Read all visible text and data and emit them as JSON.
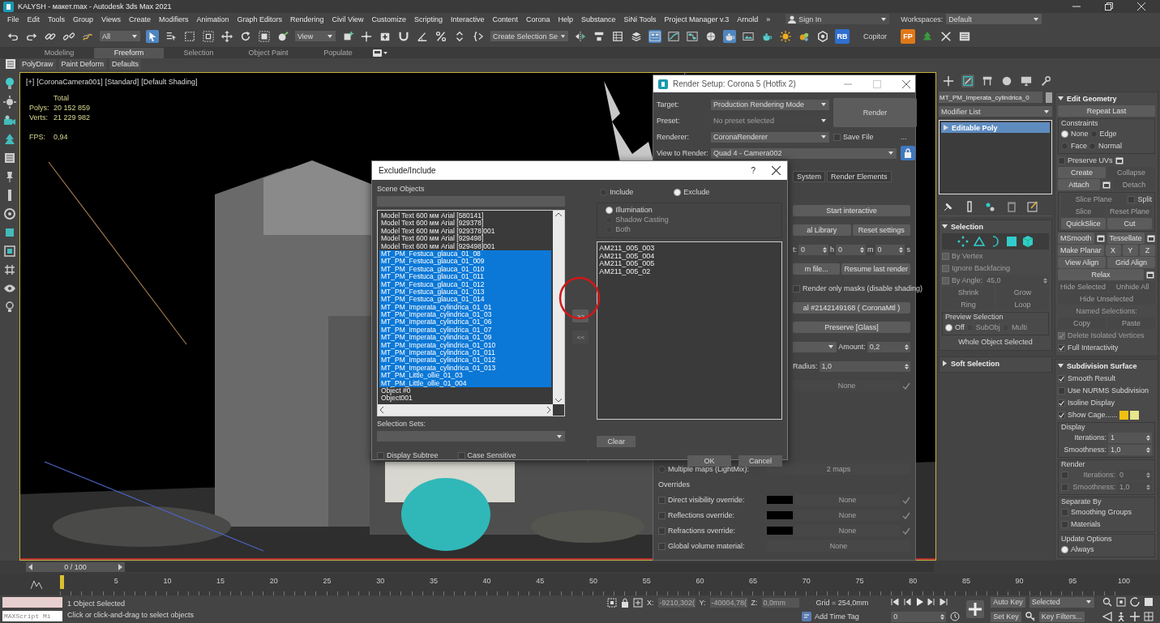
{
  "window": {
    "title": "KALYSH - макет.max - Autodesk 3ds Max 2021"
  },
  "menus": [
    "File",
    "Edit",
    "Tools",
    "Group",
    "Views",
    "Create",
    "Modifiers",
    "Animation",
    "Graph Editors",
    "Rendering",
    "Civil View",
    "Customize",
    "Scripting",
    "Interactive",
    "Content",
    "Corona",
    "Help",
    "Substance",
    "SiNi Tools",
    "Project Manager v.3",
    "Arnold"
  ],
  "more_menus": "»",
  "sign_in": "Sign In",
  "workspaces_label": "Workspaces:",
  "workspace": "Default",
  "toolbar": [
    {
      "kind": "icon",
      "on": false
    },
    {
      "kind": "icon",
      "on": false
    },
    {
      "kind": "icon",
      "on": false
    },
    {
      "kind": "icon",
      "on": false
    },
    {
      "kind": "icon",
      "on": false
    },
    {
      "kind": "dropdown",
      "text": "All"
    },
    {
      "kind": "icon",
      "on": true
    },
    {
      "kind": "icon",
      "on": false
    },
    {
      "kind": "icon",
      "on": false
    },
    {
      "kind": "icon",
      "on": false
    },
    {
      "kind": "icon",
      "on": false
    },
    {
      "kind": "icon",
      "on": false
    },
    {
      "kind": "icon",
      "on": false
    },
    {
      "kind": "icon",
      "on": false
    },
    {
      "kind": "dropdown",
      "text": "View"
    },
    {
      "kind": "icon",
      "on": false
    },
    {
      "kind": "icon",
      "on": false
    },
    {
      "kind": "icon",
      "on": false
    },
    {
      "kind": "icon",
      "on": false
    },
    {
      "kind": "icon",
      "on": false
    },
    {
      "kind": "icon",
      "on": false
    },
    {
      "kind": "icon",
      "on": false
    },
    {
      "kind": "icon",
      "on": false
    },
    {
      "kind": "dropdown",
      "text": "Create Selection Se"
    },
    {
      "kind": "icon",
      "on": false
    },
    {
      "kind": "icon",
      "on": false
    },
    {
      "kind": "icon",
      "on": false
    },
    {
      "kind": "icon",
      "on": false
    },
    {
      "kind": "icon",
      "on": true
    },
    {
      "kind": "icon",
      "on": false
    },
    {
      "kind": "icon",
      "on": false
    },
    {
      "kind": "icon",
      "on": false
    },
    {
      "kind": "icon",
      "on": true
    },
    {
      "kind": "icon",
      "on": false
    },
    {
      "kind": "icon",
      "on": false
    },
    {
      "kind": "icon",
      "on": false
    },
    {
      "kind": "icon",
      "on": false
    },
    {
      "kind": "icon",
      "on": false
    },
    {
      "kind": "badge",
      "text": "RB",
      "color": "#2f6fd0"
    },
    {
      "kind": "label",
      "text": "Copitor"
    },
    {
      "kind": "badge",
      "text": "FP",
      "color": "#e07818"
    },
    {
      "kind": "icon",
      "on": false
    },
    {
      "kind": "icon",
      "on": false
    },
    {
      "kind": "icon",
      "on": false
    }
  ],
  "ribbon": {
    "tabs": [
      {
        "text": "Modeling",
        "selected": false
      },
      {
        "text": "Freeform",
        "selected": true
      },
      {
        "text": "Selection",
        "selected": false
      },
      {
        "text": "Object Paint",
        "selected": false
      },
      {
        "text": "Populate",
        "selected": false
      }
    ],
    "panels": [
      "PolyDraw",
      "Paint Deform",
      "Defaults"
    ]
  },
  "viewport": {
    "labels": [
      "[+]",
      "[CoronaCamera001]",
      "[Standard]",
      "[Default Shading]"
    ],
    "stats": {
      "heading": "Total",
      "rows": [
        {
          "label": "Polys:",
          "value": "20 152 859"
        },
        {
          "label": "Verts:",
          "value": "21 229 982"
        }
      ],
      "fps_label": "FPS:",
      "fps": "0,94"
    }
  },
  "render_setup": {
    "title": "Render Setup: Corona 5 (Hotfix 2)",
    "target": {
      "label": "Target:",
      "value": "Production Rendering Mode"
    },
    "preset": {
      "label": "Preset:",
      "value": "No preset selected",
      "disabled": true
    },
    "renderer": {
      "label": "Renderer:",
      "value": "CoronaRenderer"
    },
    "render_button": "Render",
    "save_file": {
      "text": "Save File",
      "checked": false
    },
    "more_button": "...",
    "view": {
      "label": "View to Render:",
      "value": "Quad 4 - Camera002"
    },
    "lock": {
      "on": true
    },
    "tabs": [
      {
        "text": "System",
        "selected": false
      },
      {
        "text": "Render Elements",
        "selected": false
      }
    ],
    "band_rows": [
      [
        {
          "kind": "button",
          "text": "Start interactive",
          "disabled": false
        }
      ],
      [
        {
          "kind": "button",
          "text": "al Library",
          "disabled": false
        },
        {
          "kind": "button",
          "text": "Reset settings",
          "disabled": false
        }
      ],
      [
        {
          "kind": "label",
          "text": "t:",
          "disabled": false
        },
        {
          "kind": "spinner",
          "text": "0",
          "disabled": false
        },
        {
          "kind": "label",
          "text": "h",
          "disabled": false
        },
        {
          "kind": "spinner",
          "text": "0",
          "disabled": false
        },
        {
          "kind": "label",
          "text": "m",
          "disabled": false
        },
        {
          "kind": "spinner",
          "text": "0",
          "disabled": false
        },
        {
          "kind": "label",
          "text": "s",
          "disabled": false
        }
      ],
      [
        {
          "kind": "button",
          "text": "m file...",
          "disabled": false
        },
        {
          "kind": "button",
          "text": "Resume last render",
          "disabled": false
        }
      ],
      [
        {
          "kind": "checkbox",
          "text": "Render only masks (disable shading)",
          "checked": false,
          "disabled": false
        }
      ],
      [
        {
          "kind": "button",
          "text": "al #2142149168 ( CoronaMtl )",
          "disabled": false
        }
      ],
      [
        {
          "kind": "button",
          "text": "Preserve [Glass]",
          "disabled": false
        }
      ],
      [
        {
          "kind": "dropdown",
          "disabled": false
        },
        {
          "kind": "label",
          "text": "Amount:",
          "disabled": false
        },
        {
          "kind": "spinner",
          "text": "0,2",
          "disabled": false
        }
      ],
      [
        {
          "kind": "label",
          "text": "Radius:",
          "disabled": false
        },
        {
          "kind": "spinner",
          "text": "1,0",
          "disabled": false
        }
      ],
      [
        {
          "kind": "button",
          "text": "None",
          "disabled": true
        },
        {
          "kind": "tick",
          "checked": true,
          "disabled": true
        }
      ]
    ],
    "rows": [
      [
        {
          "kind": "radio",
          "text": "Multiple maps (LightMix):",
          "selected": false,
          "disabled": false
        },
        {
          "kind": "button",
          "text": "2 maps",
          "disabled": true
        }
      ],
      [
        {
          "kind": "label",
          "text": "Overrides",
          "disabled": false
        }
      ],
      [
        {
          "kind": "checkbox",
          "text": "Direct visibility override:",
          "checked": false,
          "disabled": false
        },
        {
          "kind": "swatch",
          "color": "#000000",
          "disabled": false
        },
        {
          "kind": "button",
          "text": "None",
          "disabled": true
        },
        {
          "kind": "tick",
          "checked": true,
          "disabled": true
        }
      ],
      [
        {
          "kind": "checkbox",
          "text": "Reflections override:",
          "checked": false,
          "disabled": false
        },
        {
          "kind": "swatch",
          "color": "#000000",
          "disabled": false
        },
        {
          "kind": "button",
          "text": "None",
          "disabled": true
        },
        {
          "kind": "tick",
          "checked": true,
          "disabled": true
        }
      ],
      [
        {
          "kind": "checkbox",
          "text": "Refractions override:",
          "checked": false,
          "disabled": false
        },
        {
          "kind": "swatch",
          "color": "#000000",
          "disabled": false
        },
        {
          "kind": "button",
          "text": "None",
          "disabled": true
        },
        {
          "kind": "tick",
          "checked": true,
          "disabled": true
        }
      ],
      [
        {
          "kind": "checkbox",
          "text": "Global volume material:",
          "checked": false,
          "disabled": false
        },
        {
          "kind": "button",
          "text": "None",
          "disabled": true
        }
      ]
    ]
  },
  "exclude_dialog": {
    "title": "Exclude/Include",
    "help": "?",
    "scene_label": "Scene Objects",
    "scene_objects": [
      {
        "text": "Model Text 600 мм Arial [580141]",
        "selected": false
      },
      {
        "text": "Model Text 600 мм Arial [929378]",
        "selected": false
      },
      {
        "text": "Model Text 600 мм Arial [929378]001",
        "selected": false
      },
      {
        "text": "Model Text 600 мм Arial [929498]",
        "selected": false
      },
      {
        "text": "Model Text 600 мм Arial [929498]001",
        "selected": false
      },
      {
        "text": "MT_PM_Festuca_glauca_01_08",
        "selected": true
      },
      {
        "text": "MT_PM_Festuca_glauca_01_009",
        "selected": true
      },
      {
        "text": "MT_PM_Festuca_glauca_01_010",
        "selected": true
      },
      {
        "text": "MT_PM_Festuca_glauca_01_011",
        "selected": true
      },
      {
        "text": "MT_PM_Festuca_glauca_01_012",
        "selected": true
      },
      {
        "text": "MT_PM_Festuca_glauca_01_013",
        "selected": true
      },
      {
        "text": "MT_PM_Festuca_glauca_01_014",
        "selected": true
      },
      {
        "text": "MT_PM_Imperata_cylindrica_01_01",
        "selected": true
      },
      {
        "text": "MT_PM_Imperata_cylindrica_01_03",
        "selected": true
      },
      {
        "text": "MT_PM_Imperata_cylindrica_01_06",
        "selected": true
      },
      {
        "text": "MT_PM_Imperata_cylindrica_01_07",
        "selected": true
      },
      {
        "text": "MT_PM_Imperata_cylindrica_01_09",
        "selected": true
      },
      {
        "text": "MT_PM_Imperata_cylindrica_01_010",
        "selected": true
      },
      {
        "text": "MT_PM_Imperata_cylindrica_01_011",
        "selected": true
      },
      {
        "text": "MT_PM_Imperata_cylindrica_01_012",
        "selected": true
      },
      {
        "text": "MT_PM_Imperata_cylindrica_01_013",
        "selected": true
      },
      {
        "text": "MT_PM_Little_ollie_01_03",
        "selected": true
      },
      {
        "text": "MT_PM_Little_ollie_01_004",
        "selected": true
      },
      {
        "text": "Object #0",
        "selected": false
      },
      {
        "text": "Object001",
        "selected": false
      }
    ],
    "move_right": {
      "text": ">>",
      "disabled": false
    },
    "move_left": {
      "text": "<<",
      "disabled": true
    },
    "mode": [
      {
        "text": "Include",
        "selected": false
      },
      {
        "text": "Exclude",
        "selected": true
      }
    ],
    "type": [
      {
        "text": "Illumination",
        "selected": true,
        "disabled": false
      },
      {
        "text": "Shadow Casting",
        "selected": false,
        "disabled": true
      },
      {
        "text": "Both",
        "selected": false,
        "disabled": true
      }
    ],
    "excluded": [
      "AM211_005_003",
      "AM211_005_004",
      "AM211_005_005",
      "AM211_005_02"
    ],
    "selection_sets_label": "Selection Sets:",
    "clear": "Clear",
    "options": [
      {
        "text": "Display Subtree",
        "checked": false
      },
      {
        "text": "Case Sensitive",
        "checked": false
      }
    ],
    "ok": "OK",
    "cancel": "Cancel"
  },
  "command_panel": {
    "tabs": [
      {
        "selected": false
      },
      {
        "selected": true
      },
      {
        "selected": false
      },
      {
        "selected": false
      },
      {
        "selected": false
      },
      {
        "selected": false
      }
    ],
    "object_name": "MT_PM_Imperata_cylindrica_0",
    "modifier_list": "Modifier List",
    "stack": [
      {
        "text": "Editable Poly",
        "selected": true
      }
    ],
    "left_rollouts": [
      {
        "title": "Selection",
        "expanded": true,
        "rows": [
          [
            {
              "kind": "subobj",
              "selected": false,
              "disabled": false
            },
            {
              "kind": "subobj",
              "selected": false,
              "disabled": false
            },
            {
              "kind": "subobj",
              "selected": false,
              "disabled": false
            },
            {
              "kind": "subobj",
              "selected": false,
              "disabled": false
            },
            {
              "kind": "subobj",
              "selected": false,
              "disabled": false
            }
          ],
          [
            {
              "kind": "checkbox",
              "text": "By Vertex",
              "checked": false,
              "disabled": true
            }
          ],
          [
            {
              "kind": "checkbox",
              "text": "Ignore Backfacing",
              "checked": false,
              "disabled": true
            }
          ],
          [
            {
              "kind": "checkbox",
              "text": "By Angle:",
              "checked": false,
              "disabled": true
            },
            {
              "kind": "spinner",
              "text": "45,0",
              "disabled": true
            }
          ],
          [
            {
              "kind": "button",
              "text": "Shrink",
              "disabled": true
            },
            {
              "kind": "button",
              "text": "Grow",
              "disabled": true
            }
          ],
          [
            {
              "kind": "button",
              "text": "Ring",
              "disabled": true
            },
            {
              "kind": "button",
              "text": "Loop",
              "disabled": true
            }
          ],
          {
            "title": "Preview Selection",
            "rows": [
              [
                {
                  "kind": "radio",
                  "text": "Off",
                  "selected": true,
                  "disabled": false
                },
                {
                  "kind": "radio",
                  "text": "SubObj",
                  "selected": false,
                  "disabled": true
                },
                {
                  "kind": "radio",
                  "text": "Multi",
                  "selected": false,
                  "disabled": true
                }
              ]
            ]
          },
          [
            {
              "kind": "label",
              "text": "Whole Object Selected",
              "disabled": false
            }
          ]
        ]
      },
      {
        "title": "Soft Selection",
        "expanded": false
      }
    ],
    "right_rollouts": [
      {
        "title": "Edit Geometry",
        "expanded": true,
        "rows": [
          [
            {
              "kind": "button",
              "text": "Repeat Last",
              "disabled": false
            }
          ],
          {
            "title": "Constraints",
            "rows": [
              [
                {
                  "kind": "radio",
                  "text": "None",
                  "selected": true,
                  "disabled": false
                },
                {
                  "kind": "radio",
                  "text": "Edge",
                  "selected": false,
                  "disabled": false
                }
              ],
              [
                {
                  "kind": "radio",
                  "text": "Face",
                  "selected": false,
                  "disabled": false
                },
                {
                  "kind": "radio",
                  "text": "Normal",
                  "selected": false,
                  "disabled": false
                }
              ]
            ]
          },
          [
            {
              "kind": "checkbox",
              "text": "Preserve UVs",
              "checked": false,
              "disabled": false
            },
            {
              "kind": "optbtn",
              "disabled": false
            }
          ],
          [
            {
              "kind": "button",
              "text": "Create",
              "disabled": false
            },
            {
              "kind": "button",
              "text": "Collapse",
              "disabled": true
            }
          ],
          [
            {
              "kind": "button",
              "text": "Attach",
              "disabled": false
            },
            {
              "kind": "optbtn",
              "disabled": false
            },
            {
              "kind": "button",
              "text": "Detach",
              "disabled": true
            }
          ],
          {
            "rows": [
              [
                {
                  "kind": "button",
                  "text": "Slice Plane",
                  "disabled": true
                },
                {
                  "kind": "checkbox",
                  "text": "Split",
                  "checked": false,
                  "disabled": false
                }
              ],
              [
                {
                  "kind": "button",
                  "text": "Slice",
                  "disabled": true
                },
                {
                  "kind": "button",
                  "text": "Reset Plane",
                  "disabled": true
                }
              ],
              [
                {
                  "kind": "button",
                  "text": "QuickSlice",
                  "disabled": false
                },
                {
                  "kind": "button",
                  "text": "Cut",
                  "disabled": false
                }
              ]
            ]
          },
          [
            {
              "kind": "button",
              "text": "MSmooth",
              "disabled": false
            },
            {
              "kind": "optbtn",
              "disabled": false
            },
            {
              "kind": "button",
              "text": "Tessellate",
              "disabled": false
            },
            {
              "kind": "optbtn",
              "disabled": false
            }
          ],
          [
            {
              "kind": "button",
              "text": "Make Planar",
              "disabled": false
            },
            {
              "kind": "button",
              "text": "X",
              "disabled": false
            },
            {
              "kind": "button",
              "text": "Y",
              "disabled": false
            },
            {
              "kind": "button",
              "text": "Z",
              "disabled": false
            }
          ],
          [
            {
              "kind": "button",
              "text": "View Align",
              "disabled": false
            },
            {
              "kind": "button",
              "text": "Grid Align",
              "disabled": false
            }
          ],
          [
            {
              "kind": "button",
              "text": "Relax",
              "disabled": false
            },
            {
              "kind": "optbtn",
              "disabled": false
            }
          ],
          [
            {
              "kind": "button",
              "text": "Hide Selected",
              "disabled": true
            },
            {
              "kind": "button",
              "text": "Unhide All",
              "disabled": true
            }
          ],
          [
            {
              "kind": "button",
              "text": "Hide Unselected",
              "disabled": true
            }
          ],
          [
            {
              "kind": "label",
              "text": "Named Selections:",
              "disabled": true
            }
          ],
          [
            {
              "kind": "button",
              "text": "Copy",
              "disabled": true
            },
            {
              "kind": "button",
              "text": "Paste",
              "disabled": true
            }
          ],
          [
            {
              "kind": "checkbox",
              "text": "Delete Isolated Vertices",
              "checked": true,
              "disabled": true
            }
          ],
          [
            {
              "kind": "checkbox",
              "text": "Full Interactivity",
              "checked": true,
              "disabled": false
            }
          ]
        ]
      },
      {
        "title": "Subdivision Surface",
        "expanded": true,
        "rows": [
          [
            {
              "kind": "checkbox",
              "text": "Smooth Result",
              "checked": true,
              "disabled": false
            }
          ],
          [
            {
              "kind": "checkbox",
              "text": "Use NURMS Subdivision",
              "checked": false,
              "disabled": false
            }
          ],
          [
            {
              "kind": "checkbox",
              "text": "Isoline Display",
              "checked": true,
              "disabled": false
            }
          ],
          [
            {
              "kind": "checkbox",
              "text": "Show Cage......",
              "checked": true,
              "disabled": false
            },
            {
              "kind": "swatch",
              "color": "#f0c010",
              "disabled": false
            },
            {
              "kind": "swatch",
              "color": "#e6e68c",
              "disabled": false
            }
          ],
          {
            "title": "Display",
            "rows": [
              [
                {
                  "kind": "label",
                  "text": "Iterations:",
                  "disabled": false
                },
                {
                  "kind": "spinner",
                  "text": "1",
                  "disabled": false
                }
              ],
              [
                {
                  "kind": "label",
                  "text": "Smoothness:",
                  "disabled": false
                },
                {
                  "kind": "spinner",
                  "text": "1,0",
                  "disabled": false
                }
              ]
            ]
          },
          {
            "title": "Render",
            "rows": [
              [
                {
                  "kind": "checkbox",
                  "checked": false,
                  "disabled": false
                },
                {
                  "kind": "label",
                  "text": "Iterations:",
                  "disabled": true
                },
                {
                  "kind": "spinner",
                  "text": "0",
                  "disabled": true
                }
              ],
              [
                {
                  "kind": "checkbox",
                  "checked": false,
                  "disabled": false
                },
                {
                  "kind": "label",
                  "text": "Smoothness:",
                  "disabled": true
                },
                {
                  "kind": "spinner",
                  "text": "1,0",
                  "disabled": true
                }
              ]
            ]
          },
          {
            "title": "Separate By",
            "rows": [
              [
                {
                  "kind": "checkbox",
                  "text": "Smoothing Groups",
                  "checked": false,
                  "disabled": false
                }
              ],
              [
                {
                  "kind": "checkbox",
                  "text": "Materials",
                  "checked": false,
                  "disabled": false
                }
              ]
            ]
          },
          {
            "title": "Update Options",
            "rows": [
              [
                {
                  "kind": "radio",
                  "text": "Always",
                  "selected": true,
                  "disabled": false
                }
              ]
            ]
          }
        ]
      }
    ]
  },
  "time_slider": {
    "text": "0 / 100"
  },
  "ruler": [
    "5",
    "10",
    "15",
    "20",
    "25",
    "30",
    "35",
    "40",
    "45",
    "50",
    "55",
    "60",
    "65",
    "70",
    "75",
    "80",
    "85",
    "90",
    "95",
    "100"
  ],
  "status": {
    "maxscript": "MAXScript Mi",
    "selection": "1 Object Selected",
    "prompt": "Click or click-and-drag to select objects",
    "coords": [
      {
        "label": "X:",
        "value": "-9210,302("
      },
      {
        "label": "Y:",
        "value": "-40004,78("
      },
      {
        "label": "Z:",
        "value": "0,0mm"
      }
    ],
    "grid": "Grid = 254,0mm",
    "time_tag": "Add Time Tag",
    "frame": "0",
    "auto_key": "Auto Key",
    "key_mode": "Selected",
    "set_key": "Set Key",
    "key_filters": "Key Filters..."
  }
}
